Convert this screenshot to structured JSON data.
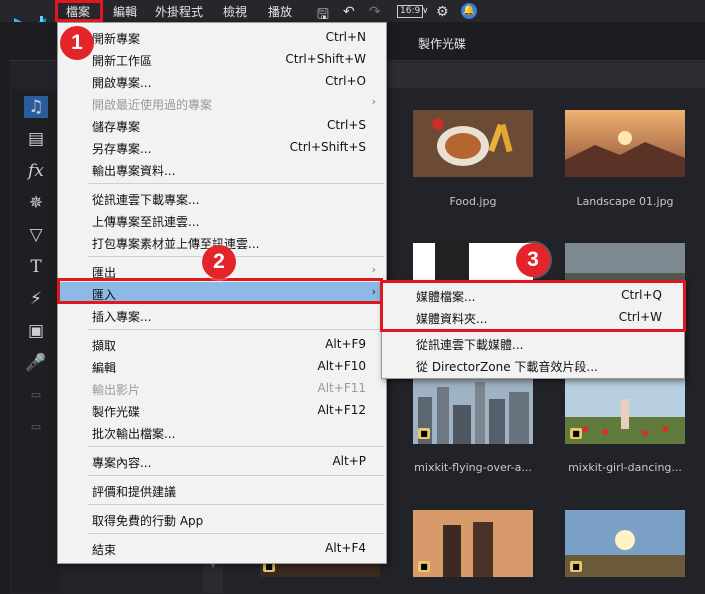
{
  "menubar": {
    "items": [
      "檔案",
      "編輯",
      "外掛程式",
      "檢視",
      "播放"
    ],
    "ratio_label": "16:9"
  },
  "tabs": {
    "disc": "製作光碟"
  },
  "file_menu": {
    "items": [
      {
        "label": "開新專案",
        "shortcut": "Ctrl+N"
      },
      {
        "label": "開新工作區",
        "shortcut": "Ctrl+Shift+W"
      },
      {
        "label": "開啟專案...",
        "shortcut": "Ctrl+O"
      },
      {
        "label": "開啟最近使用過的專案",
        "shortcut": ""
      },
      {
        "label": "儲存專案",
        "shortcut": "Ctrl+S"
      },
      {
        "label": "另存專案...",
        "shortcut": "Ctrl+Shift+S"
      },
      {
        "label": "輸出專案資料...",
        "shortcut": ""
      },
      {
        "label": "從訊連雲下載專案...",
        "shortcut": ""
      },
      {
        "label": "上傳專案至訊連雲...",
        "shortcut": ""
      },
      {
        "label": "打包專案素材並上傳至訊連雲...",
        "shortcut": ""
      },
      {
        "label": "匯出",
        "shortcut": ""
      },
      {
        "label": "匯入",
        "shortcut": ""
      },
      {
        "label": "插入專案...",
        "shortcut": ""
      },
      {
        "label": "擷取",
        "shortcut": "Alt+F9"
      },
      {
        "label": "編輯",
        "shortcut": "Alt+F10"
      },
      {
        "label": "輸出影片",
        "shortcut": "Alt+F11"
      },
      {
        "label": "製作光碟",
        "shortcut": "Alt+F12"
      },
      {
        "label": "批次輸出檔案...",
        "shortcut": ""
      },
      {
        "label": "專案內容...",
        "shortcut": "Alt+P"
      },
      {
        "label": "評價和提供建議",
        "shortcut": ""
      },
      {
        "label": "取得免費的行動 App",
        "shortcut": ""
      },
      {
        "label": "結束",
        "shortcut": "Alt+F4"
      }
    ]
  },
  "import_submenu": {
    "items": [
      {
        "label": "媒體檔案...",
        "shortcut": "Ctrl+Q"
      },
      {
        "label": "媒體資料夾...",
        "shortcut": "Ctrl+W"
      },
      {
        "label": "從訊連雲下載媒體...",
        "shortcut": ""
      },
      {
        "label": "從 DirectorZone 下載音效片段...",
        "shortcut": ""
      }
    ]
  },
  "media": {
    "items": [
      "Food.jpg",
      "Landscape 01.jpg",
      "mixkit-flying-over-a...",
      "mixkit-girl-dancing..."
    ]
  },
  "callouts": [
    "1",
    "2",
    "3"
  ],
  "colors": {
    "highlight": "#8db9e6",
    "callout_red": "#e3252b",
    "accent_blue": "#3b7ee0"
  }
}
